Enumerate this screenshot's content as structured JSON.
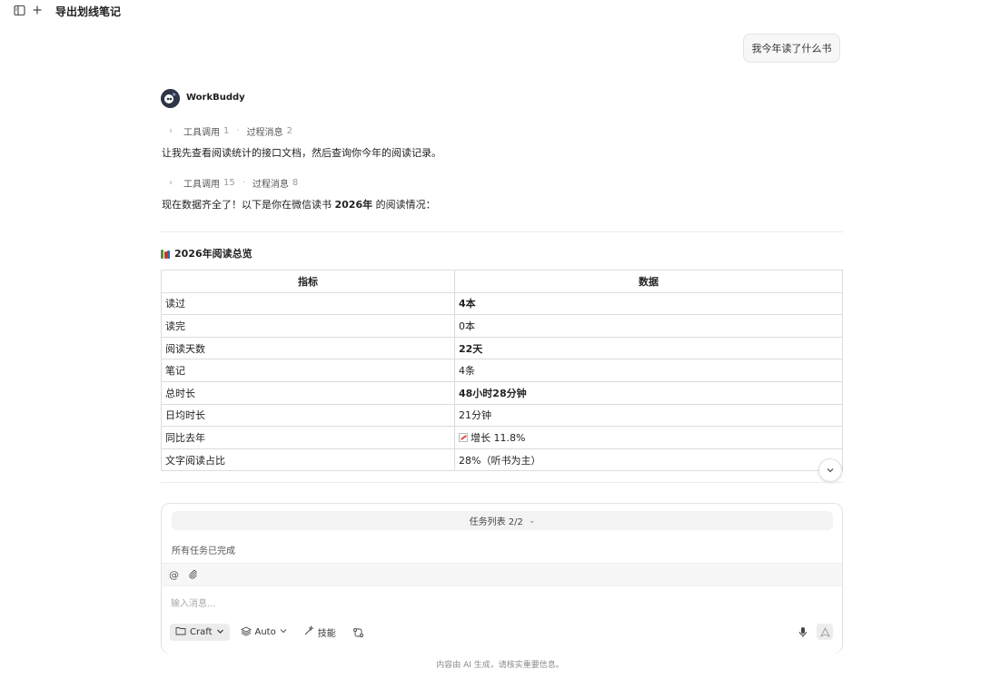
{
  "topbar": {
    "title": "导出划线笔记",
    "sidebar_icon": "sidebar-toggle-icon",
    "new_icon": "plus-icon"
  },
  "user_message": "我今年读了什么书",
  "assistant": {
    "name": "WorkBuddy",
    "tool_block_1": {
      "tool_label": "工具调用",
      "tool_count": "1",
      "process_label": "过程消息",
      "process_count": "2"
    },
    "message_1": "让我先查看阅读统计的接口文档，然后查询你今年的阅读记录。",
    "tool_block_2": {
      "tool_label": "工具调用",
      "tool_count": "15",
      "process_label": "过程消息",
      "process_count": "8"
    },
    "message_2_prefix": "现在数据齐全了！以下是你在微信读书 ",
    "message_2_bold": "2026年",
    "message_2_suffix": " 的阅读情况：",
    "section_title": "2026年阅读总览",
    "table": {
      "headers": [
        "指标",
        "数据"
      ],
      "rows": [
        {
          "metric": "读过",
          "value": "4本",
          "bold": true
        },
        {
          "metric": "读完",
          "value": "0本",
          "bold": false
        },
        {
          "metric": "阅读天数",
          "value": "22天",
          "bold": true
        },
        {
          "metric": "笔记",
          "value": "4条",
          "bold": false
        },
        {
          "metric": "总时长",
          "value": "48小时28分钟",
          "bold": true
        },
        {
          "metric": "日均时长",
          "value": "21分钟",
          "bold": false
        },
        {
          "metric": "同比去年",
          "value": "增长 11.8%",
          "bold": false
        },
        {
          "metric": "文字阅读占比",
          "value": "28%（听书为主）",
          "bold": false
        }
      ]
    }
  },
  "composer": {
    "task_list_label": "任务列表 2/2",
    "task_status": "所有任务已完成",
    "input_placeholder": "输入消息...",
    "mode_button": "Craft",
    "model_button": "Auto",
    "skills_button": "技能"
  },
  "footer_note": "内容由 AI 生成，请核实重要信息。"
}
